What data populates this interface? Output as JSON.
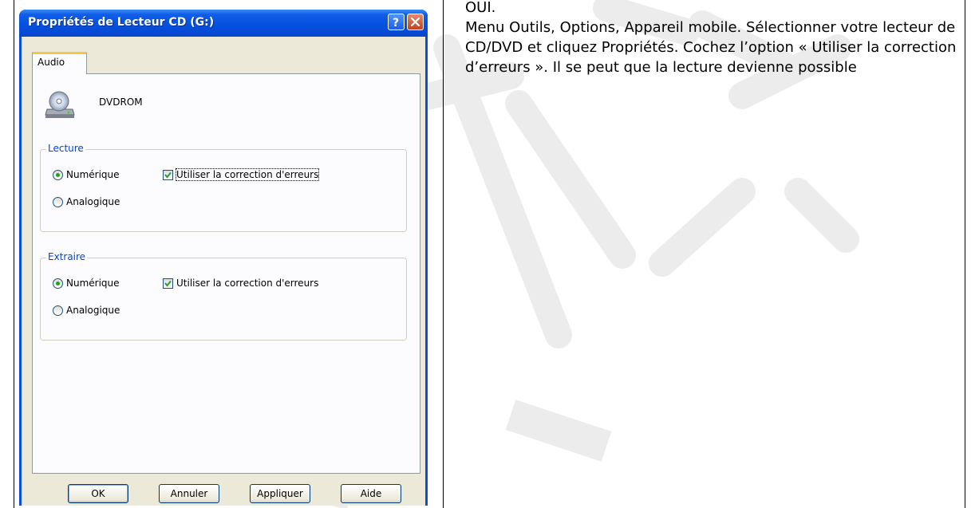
{
  "dialog": {
    "title": "Propriétés de Lecteur CD (G:)",
    "tab_label": "Audio",
    "device_name": "DVDROM",
    "groups": [
      {
        "label": "Lecture",
        "digital_label": "Numérique",
        "analog_label": "Analogique",
        "selected": "Numérique",
        "checkbox_label": "Utiliser la correction d'erreurs",
        "checkbox_checked": true
      },
      {
        "label": "Extraire",
        "digital_label": "Numérique",
        "analog_label": "Analogique",
        "selected": "Numérique",
        "checkbox_label": "Utiliser la correction d'erreurs",
        "checkbox_checked": true
      }
    ],
    "buttons": {
      "ok": "OK",
      "cancel": "Annuler",
      "apply": "Appliquer",
      "help": "Aide"
    }
  },
  "answer": {
    "line1": "OUI.",
    "line2": "Menu Outils, Options, Appareil mobile. Sélectionner votre lecteur de CD/DVD et cliquez Propriétés. Cochez l’option « Utiliser la correction d’erreurs ». Il se peut que la lecture devienne possible"
  },
  "colors": {
    "title_bar": "#0551e0",
    "group_label": "#0046d5",
    "tab_highlight": "#f4c64c",
    "radio_dot": "#21a121",
    "watermark": "#e8e8e8"
  },
  "icons": [
    "help-icon",
    "close-icon",
    "cd-drive-icon",
    "checkmark-icon"
  ]
}
